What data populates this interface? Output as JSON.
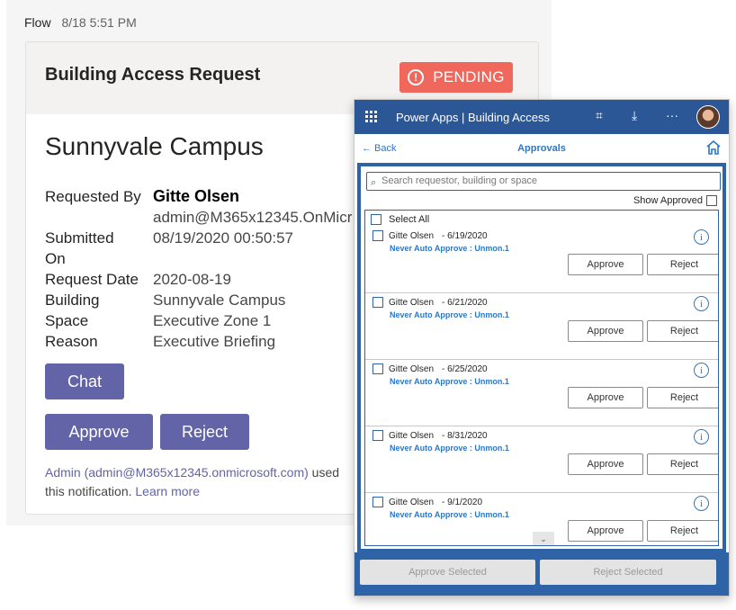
{
  "flow": {
    "sender": "Flow",
    "timestamp": "8/18 5:51 PM",
    "card": {
      "title": "Building Access Request",
      "status": "PENDING",
      "campus": "Sunnyvale Campus",
      "facts": [
        {
          "label": "Requested By",
          "value": "Gitte Olsen"
        },
        {
          "label": "Submitted On",
          "value": "08/19/2020 00:50:57"
        },
        {
          "label": "Request Date",
          "value": "2020-08-19"
        },
        {
          "label": "Building",
          "value": "Sunnyvale Campus"
        },
        {
          "label": "Space",
          "value": "Executive Zone 1"
        },
        {
          "label": "Reason",
          "value": "Executive Briefing"
        }
      ],
      "requester_email": "admin@M365x12345.OnMicr",
      "submitted_label_line1": "Submitted",
      "submitted_label_line2": "On",
      "chat_label": "Chat",
      "approve_label": "Approve",
      "reject_label": "Reject",
      "footer_admin": "Admin (admin@M365x12345.onmicrosoft.com)",
      "footer_used": " used",
      "footer_line2": "this notification. ",
      "footer_link": "Learn more"
    }
  },
  "powerapps": {
    "title": "Power Apps  |  Building Access",
    "back_label": "← Back",
    "nav_title": "Approvals",
    "search_placeholder": "Search requestor, building or space",
    "show_approved_label": "Show Approved",
    "select_all_label": "Select All",
    "items": [
      {
        "name": "Gitte Olsen",
        "date": "- 6/19/2020",
        "rule": "Never Auto Approve : Unmon.1",
        "approve": "Approve",
        "reject": "Reject"
      },
      {
        "name": "Gitte Olsen",
        "date": "- 6/21/2020",
        "rule": "Never Auto Approve : Unmon.1",
        "approve": "Approve",
        "reject": "Reject"
      },
      {
        "name": "Gitte Olsen",
        "date": "- 6/25/2020",
        "rule": "Never Auto Approve : Unmon.1",
        "approve": "Approve",
        "reject": "Reject"
      },
      {
        "name": "Gitte Olsen",
        "date": "- 8/31/2020",
        "rule": "Never Auto Approve : Unmon.1",
        "approve": "Approve",
        "reject": "Reject"
      },
      {
        "name": "Gitte Olsen",
        "date": "- 9/1/2020",
        "rule": "Never Auto Approve : Unmon.1",
        "approve": "Approve",
        "reject": "Reject"
      }
    ],
    "approve_selected_label": "Approve Selected",
    "reject_selected_label": "Reject Selected"
  },
  "colors": {
    "teams_purple": "#6264a7",
    "pending_red": "#f0675c",
    "powerapps_blue": "#2b5797",
    "link_blue": "#2b77c8"
  }
}
